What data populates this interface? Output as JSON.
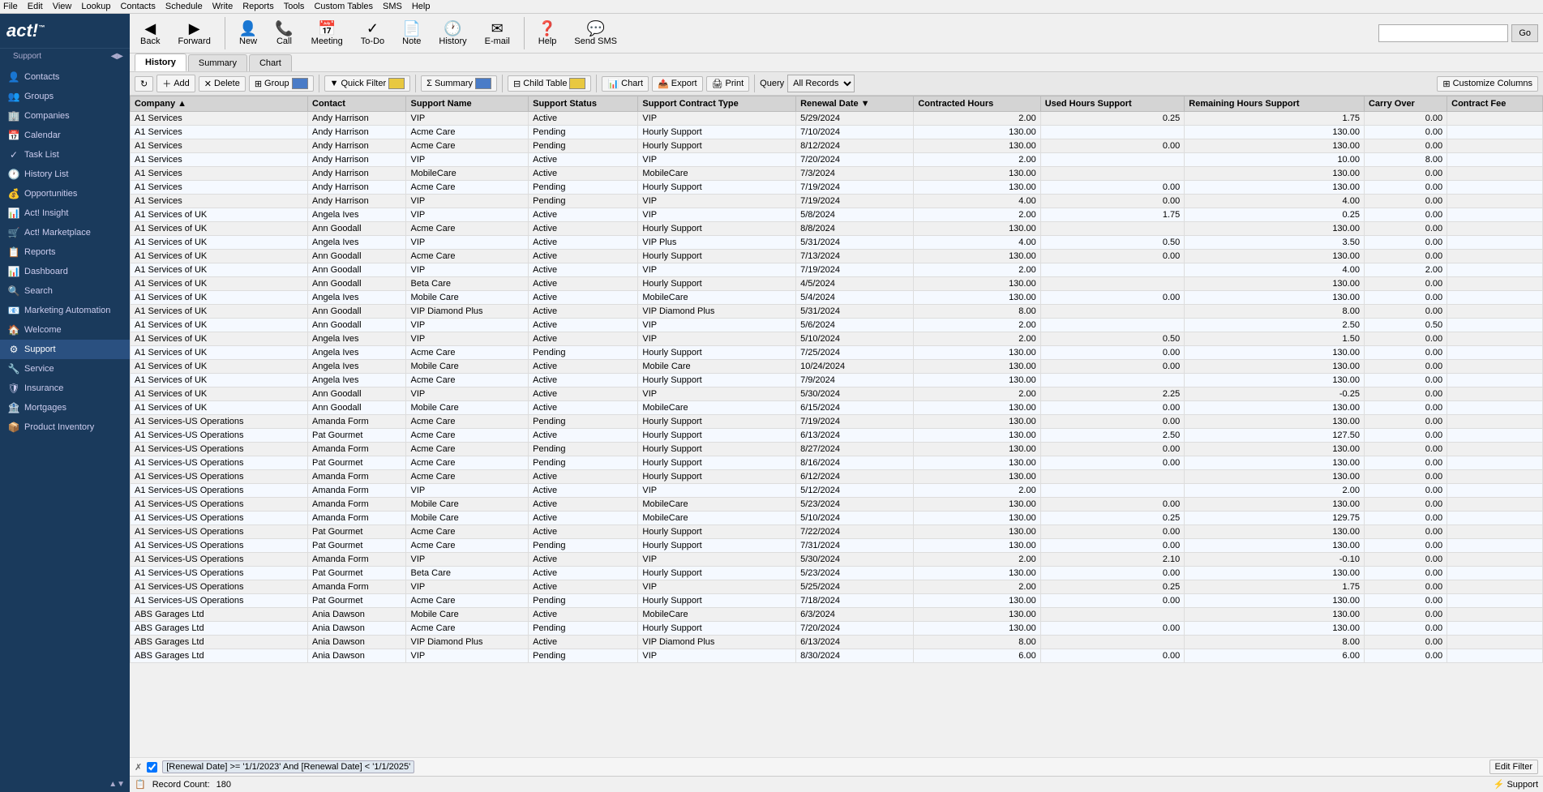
{
  "app": {
    "title": "ACT!",
    "logo": "act!",
    "tm": "™"
  },
  "menu": {
    "items": [
      "File",
      "Edit",
      "View",
      "Lookup",
      "Contacts",
      "Schedule",
      "Write",
      "Reports",
      "Tools",
      "Custom Tables",
      "SMS",
      "Help"
    ]
  },
  "toolbar": {
    "buttons": [
      {
        "label": "Back",
        "icon": "◀"
      },
      {
        "label": "Forward",
        "icon": "▶"
      },
      {
        "label": "New",
        "icon": "👤"
      },
      {
        "label": "Call",
        "icon": "📞"
      },
      {
        "label": "Meeting",
        "icon": "📅"
      },
      {
        "label": "To-Do",
        "icon": "✓"
      },
      {
        "label": "Note",
        "icon": "📄"
      },
      {
        "label": "History",
        "icon": "🕐"
      },
      {
        "label": "E-mail",
        "icon": "✉"
      },
      {
        "label": "Help",
        "icon": "?"
      },
      {
        "label": "Send SMS",
        "icon": "💬"
      }
    ],
    "search_placeholder": "",
    "go_label": "Go"
  },
  "sidebar": {
    "support_label": "Support",
    "items": [
      {
        "label": "Contacts",
        "icon": "👤",
        "active": false
      },
      {
        "label": "Groups",
        "icon": "👥",
        "active": false
      },
      {
        "label": "Companies",
        "icon": "🏢",
        "active": false
      },
      {
        "label": "Calendar",
        "icon": "📅",
        "active": false
      },
      {
        "label": "Task List",
        "icon": "✓",
        "active": false
      },
      {
        "label": "History List",
        "icon": "🕐",
        "active": false
      },
      {
        "label": "Opportunities",
        "icon": "💰",
        "active": false
      },
      {
        "label": "Act! Insight",
        "icon": "📊",
        "active": false
      },
      {
        "label": "Act! Marketplace",
        "icon": "🛒",
        "active": false
      },
      {
        "label": "Reports",
        "icon": "📋",
        "active": false
      },
      {
        "label": "Dashboard",
        "icon": "📊",
        "active": false
      },
      {
        "label": "Search",
        "icon": "🔍",
        "active": false
      },
      {
        "label": "Marketing Automation",
        "icon": "📧",
        "active": false
      },
      {
        "label": "Welcome",
        "icon": "🏠",
        "active": false
      },
      {
        "label": "Support",
        "icon": "⚙",
        "active": true
      },
      {
        "label": "Service",
        "icon": "🔧",
        "active": false
      },
      {
        "label": "Insurance",
        "icon": "🛡",
        "active": false
      },
      {
        "label": "Mortgages",
        "icon": "🏦",
        "active": false
      },
      {
        "label": "Product Inventory",
        "icon": "📦",
        "active": false
      }
    ]
  },
  "action_bar": {
    "refresh_icon": "↻",
    "add_label": "Add",
    "delete_label": "Delete",
    "group_label": "Group",
    "quick_filter_label": "Quick Filter",
    "summary_label": "Summary",
    "child_table_label": "Child Table",
    "chart_label": "Chart",
    "export_label": "Export",
    "print_label": "Print",
    "query_label": "Query",
    "all_records_label": "All Records",
    "customize_columns_label": "Customize Columns"
  },
  "tabs": {
    "history_label": "History",
    "summary_label": "Summary",
    "chart_label": "Chart"
  },
  "table": {
    "columns": [
      "Company",
      "Contact",
      "Support Name",
      "Support Status",
      "Support Contract Type",
      "Renewal Date",
      "Contracted Hours",
      "Used Hours Support",
      "Remaining Hours Support",
      "Carry Over",
      "Contract Fee"
    ],
    "rows": [
      [
        "A1 Services",
        "Andy Harrison",
        "VIP",
        "Active",
        "VIP",
        "5/29/2024",
        "2.00",
        "0.25",
        "1.75",
        "0.00",
        ""
      ],
      [
        "A1 Services",
        "Andy Harrison",
        "Acme Care",
        "Pending",
        "Hourly Support",
        "7/10/2024",
        "130.00",
        "",
        "130.00",
        "0.00",
        ""
      ],
      [
        "A1 Services",
        "Andy Harrison",
        "Acme Care",
        "Pending",
        "Hourly Support",
        "8/12/2024",
        "130.00",
        "0.00",
        "130.00",
        "0.00",
        ""
      ],
      [
        "A1 Services",
        "Andy Harrison",
        "VIP",
        "Active",
        "VIP",
        "7/20/2024",
        "2.00",
        "",
        "10.00",
        "8.00",
        ""
      ],
      [
        "A1 Services",
        "Andy Harrison",
        "MobileCare",
        "Active",
        "MobileCare",
        "7/3/2024",
        "130.00",
        "",
        "130.00",
        "0.00",
        ""
      ],
      [
        "A1 Services",
        "Andy Harrison",
        "Acme Care",
        "Pending",
        "Hourly Support",
        "7/19/2024",
        "130.00",
        "0.00",
        "130.00",
        "0.00",
        ""
      ],
      [
        "A1 Services",
        "Andy Harrison",
        "VIP",
        "Pending",
        "VIP",
        "7/19/2024",
        "4.00",
        "0.00",
        "4.00",
        "0.00",
        ""
      ],
      [
        "A1 Services of UK",
        "Angela Ives",
        "VIP",
        "Active",
        "VIP",
        "5/8/2024",
        "2.00",
        "1.75",
        "0.25",
        "0.00",
        ""
      ],
      [
        "A1 Services of UK",
        "Ann Goodall",
        "Acme Care",
        "Active",
        "Hourly Support",
        "8/8/2024",
        "130.00",
        "",
        "130.00",
        "0.00",
        ""
      ],
      [
        "A1 Services of UK",
        "Angela Ives",
        "VIP",
        "Active",
        "VIP Plus",
        "5/31/2024",
        "4.00",
        "0.50",
        "3.50",
        "0.00",
        ""
      ],
      [
        "A1 Services of UK",
        "Ann Goodall",
        "Acme Care",
        "Active",
        "Hourly Support",
        "7/13/2024",
        "130.00",
        "0.00",
        "130.00",
        "0.00",
        ""
      ],
      [
        "A1 Services of UK",
        "Ann Goodall",
        "VIP",
        "Active",
        "VIP",
        "7/19/2024",
        "2.00",
        "",
        "4.00",
        "2.00",
        ""
      ],
      [
        "A1 Services of UK",
        "Ann Goodall",
        "Beta Care",
        "Active",
        "Hourly Support",
        "4/5/2024",
        "130.00",
        "",
        "130.00",
        "0.00",
        ""
      ],
      [
        "A1 Services of UK",
        "Angela Ives",
        "Mobile Care",
        "Active",
        "MobileCare",
        "5/4/2024",
        "130.00",
        "0.00",
        "130.00",
        "0.00",
        ""
      ],
      [
        "A1 Services of UK",
        "Ann Goodall",
        "VIP Diamond Plus",
        "Active",
        "VIP Diamond Plus",
        "5/31/2024",
        "8.00",
        "",
        "8.00",
        "0.00",
        ""
      ],
      [
        "A1 Services of UK",
        "Ann Goodall",
        "VIP",
        "Active",
        "VIP",
        "5/6/2024",
        "2.00",
        "",
        "2.50",
        "0.50",
        ""
      ],
      [
        "A1 Services of UK",
        "Angela Ives",
        "VIP",
        "Active",
        "VIP",
        "5/10/2024",
        "2.00",
        "0.50",
        "1.50",
        "0.00",
        ""
      ],
      [
        "A1 Services of UK",
        "Angela Ives",
        "Acme Care",
        "Pending",
        "Hourly Support",
        "7/25/2024",
        "130.00",
        "0.00",
        "130.00",
        "0.00",
        ""
      ],
      [
        "A1 Services of UK",
        "Angela Ives",
        "Mobile Care",
        "Active",
        "Mobile Care",
        "10/24/2024",
        "130.00",
        "0.00",
        "130.00",
        "0.00",
        ""
      ],
      [
        "A1 Services of UK",
        "Angela Ives",
        "Acme Care",
        "Active",
        "Hourly Support",
        "7/9/2024",
        "130.00",
        "",
        "130.00",
        "0.00",
        ""
      ],
      [
        "A1 Services of UK",
        "Ann Goodall",
        "VIP",
        "Active",
        "VIP",
        "5/30/2024",
        "2.00",
        "2.25",
        "-0.25",
        "0.00",
        ""
      ],
      [
        "A1 Services of UK",
        "Ann Goodall",
        "Mobile Care",
        "Active",
        "MobileCare",
        "6/15/2024",
        "130.00",
        "0.00",
        "130.00",
        "0.00",
        ""
      ],
      [
        "A1 Services-US Operations",
        "Amanda Form",
        "Acme Care",
        "Pending",
        "Hourly Support",
        "7/19/2024",
        "130.00",
        "0.00",
        "130.00",
        "0.00",
        ""
      ],
      [
        "A1 Services-US Operations",
        "Pat Gourmet",
        "Acme Care",
        "Active",
        "Hourly Support",
        "6/13/2024",
        "130.00",
        "2.50",
        "127.50",
        "0.00",
        ""
      ],
      [
        "A1 Services-US Operations",
        "Amanda Form",
        "Acme Care",
        "Pending",
        "Hourly Support",
        "8/27/2024",
        "130.00",
        "0.00",
        "130.00",
        "0.00",
        ""
      ],
      [
        "A1 Services-US Operations",
        "Pat Gourmet",
        "Acme Care",
        "Pending",
        "Hourly Support",
        "8/16/2024",
        "130.00",
        "0.00",
        "130.00",
        "0.00",
        ""
      ],
      [
        "A1 Services-US Operations",
        "Amanda Form",
        "Acme Care",
        "Active",
        "Hourly Support",
        "6/12/2024",
        "130.00",
        "",
        "130.00",
        "0.00",
        ""
      ],
      [
        "A1 Services-US Operations",
        "Amanda Form",
        "VIP",
        "Active",
        "VIP",
        "5/12/2024",
        "2.00",
        "",
        "2.00",
        "0.00",
        ""
      ],
      [
        "A1 Services-US Operations",
        "Amanda Form",
        "Mobile Care",
        "Active",
        "MobileCare",
        "5/23/2024",
        "130.00",
        "0.00",
        "130.00",
        "0.00",
        ""
      ],
      [
        "A1 Services-US Operations",
        "Amanda Form",
        "Mobile Care",
        "Active",
        "MobileCare",
        "5/10/2024",
        "130.00",
        "0.25",
        "129.75",
        "0.00",
        ""
      ],
      [
        "A1 Services-US Operations",
        "Pat Gourmet",
        "Acme Care",
        "Active",
        "Hourly Support",
        "7/22/2024",
        "130.00",
        "0.00",
        "130.00",
        "0.00",
        ""
      ],
      [
        "A1 Services-US Operations",
        "Pat Gourmet",
        "Acme Care",
        "Pending",
        "Hourly Support",
        "7/31/2024",
        "130.00",
        "0.00",
        "130.00",
        "0.00",
        ""
      ],
      [
        "A1 Services-US Operations",
        "Amanda Form",
        "VIP",
        "Active",
        "VIP",
        "5/30/2024",
        "2.00",
        "2.10",
        "-0.10",
        "0.00",
        ""
      ],
      [
        "A1 Services-US Operations",
        "Pat Gourmet",
        "Beta Care",
        "Active",
        "Hourly Support",
        "5/23/2024",
        "130.00",
        "0.00",
        "130.00",
        "0.00",
        ""
      ],
      [
        "A1 Services-US Operations",
        "Amanda Form",
        "VIP",
        "Active",
        "VIP",
        "5/25/2024",
        "2.00",
        "0.25",
        "1.75",
        "0.00",
        ""
      ],
      [
        "A1 Services-US Operations",
        "Pat Gourmet",
        "Acme Care",
        "Pending",
        "Hourly Support",
        "7/18/2024",
        "130.00",
        "0.00",
        "130.00",
        "0.00",
        ""
      ],
      [
        "ABS Garages Ltd",
        "Ania Dawson",
        "Mobile Care",
        "Active",
        "MobileCare",
        "6/3/2024",
        "130.00",
        "",
        "130.00",
        "0.00",
        ""
      ],
      [
        "ABS Garages Ltd",
        "Ania Dawson",
        "Acme Care",
        "Pending",
        "Hourly Support",
        "7/20/2024",
        "130.00",
        "0.00",
        "130.00",
        "0.00",
        ""
      ],
      [
        "ABS Garages Ltd",
        "Ania Dawson",
        "VIP Diamond Plus",
        "Active",
        "VIP Diamond Plus",
        "6/13/2024",
        "8.00",
        "",
        "8.00",
        "0.00",
        ""
      ],
      [
        "ABS Garages Ltd",
        "Ania Dawson",
        "VIP",
        "Pending",
        "VIP",
        "8/30/2024",
        "6.00",
        "0.00",
        "6.00",
        "0.00",
        ""
      ]
    ]
  },
  "filter": {
    "close_icon": "✗",
    "checkbox_label": "",
    "filter_text": "[Renewal Date] >= '1/1/2023' And [Renewal Date] < '1/1/2025'",
    "edit_filter_label": "Edit Filter"
  },
  "status": {
    "record_count_label": "Record Count:",
    "record_count": "180",
    "support_label": "⚡ Support"
  }
}
